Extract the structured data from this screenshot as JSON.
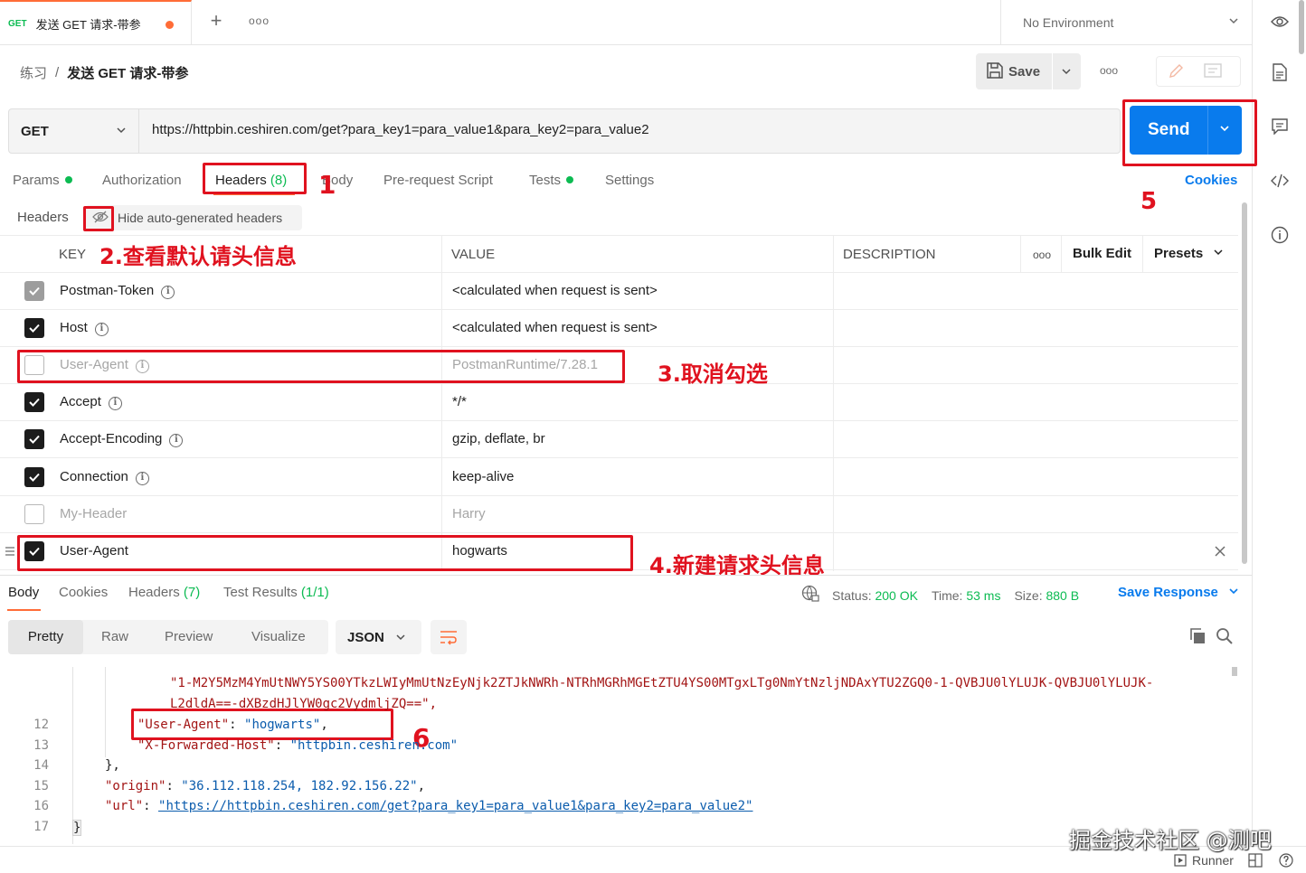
{
  "tab": {
    "method": "GET",
    "title": "发送 GET 请求-带参"
  },
  "environment": "No Environment",
  "breadcrumb": {
    "collection": "练习",
    "separator": "/",
    "request": "发送 GET 请求-带参"
  },
  "toolbar": {
    "save_label": "Save"
  },
  "request": {
    "method": "GET",
    "url": "https://httpbin.ceshiren.com/get?para_key1=para_value1&para_key2=para_value2",
    "send_label": "Send"
  },
  "request_tabs": {
    "params": "Params",
    "authorization": "Authorization",
    "headers": "Headers",
    "headers_count": "(8)",
    "body": "Body",
    "prerequest": "Pre-request Script",
    "tests": "Tests",
    "settings": "Settings",
    "cookies": "Cookies"
  },
  "headers_section": {
    "title": "Headers",
    "hide_auto": "Hide auto-generated headers"
  },
  "table": {
    "col_key": "KEY",
    "col_value": "VALUE",
    "col_description": "DESCRIPTION",
    "bulk_edit": "Bulk Edit",
    "presets": "Presets",
    "rows": [
      {
        "key": "Postman-Token",
        "value": "<calculated when request is sent>",
        "state": "grey",
        "info": true
      },
      {
        "key": "Host",
        "value": "<calculated when request is sent>",
        "state": "on",
        "info": true
      },
      {
        "key": "User-Agent",
        "value": "PostmanRuntime/7.28.1",
        "state": "off",
        "info": true
      },
      {
        "key": "Accept",
        "value": "*/*",
        "state": "on",
        "info": true
      },
      {
        "key": "Accept-Encoding",
        "value": "gzip, deflate, br",
        "state": "on",
        "info": true
      },
      {
        "key": "Connection",
        "value": "keep-alive",
        "state": "on",
        "info": true
      },
      {
        "key": "My-Header",
        "value": "Harry",
        "state": "off",
        "info": false
      },
      {
        "key": "User-Agent",
        "value": "hogwarts",
        "state": "on",
        "info": false
      }
    ]
  },
  "annotations": {
    "a1": "1",
    "a2": "2.查看默认请头信息",
    "a3": "3.取消勾选",
    "a4": "4.新建请求头信息",
    "a5": "5",
    "a6": "6"
  },
  "response_tabs": {
    "body": "Body",
    "cookies": "Cookies",
    "headers": "Headers",
    "headers_count": "(7)",
    "test_results": "Test Results",
    "test_results_count": "(1/1)"
  },
  "response_status": {
    "status_label": "Status:",
    "status_value": "200 OK",
    "time_label": "Time:",
    "time_value": "53 ms",
    "size_label": "Size:",
    "size_value": "880 B",
    "save_response": "Save Response"
  },
  "view_tabs": {
    "pretty": "Pretty",
    "raw": "Raw",
    "preview": "Preview",
    "visualize": "Visualize",
    "format": "JSON"
  },
  "code": {
    "line_12": "12",
    "line_13": "13",
    "line_14": "14",
    "line_15": "15",
    "line_16": "16",
    "line_17": "17",
    "trace_line1": "\"1-M2Y5MzM4YmUtNWY5YS00YTkzLWIyMmUtNzEyNjk2ZTJkNWRh-NTRhMGRhMGEtZTU4YS00MTgxLTg0NmYtNzljNDAxYTU2ZGQ0-1-QVBJU0lYLUJK-QVBJU0lYLUJK-",
    "trace_line2": "L2dldA==-dXBzdHJlYW0gc2VydmljZQ==\",",
    "ua_key": "\"User-Agent\"",
    "ua_val": "\"hogwarts\"",
    "xfh_key": "\"X-Forwarded-Host\"",
    "xfh_val": "\"httpbin.ceshiren.com\"",
    "close_brace": "},",
    "origin_key": "\"origin\"",
    "origin_val": "\"36.112.118.254, 182.92.156.22\"",
    "url_key": "\"url\"",
    "url_val": "\"https://httpbin.ceshiren.com/get?para_key1=para_value1&para_key2=para_value2\"",
    "end_brace": "}"
  },
  "statusbar": {
    "runner": "Runner"
  },
  "watermark": "掘金技术社区 @测吧"
}
